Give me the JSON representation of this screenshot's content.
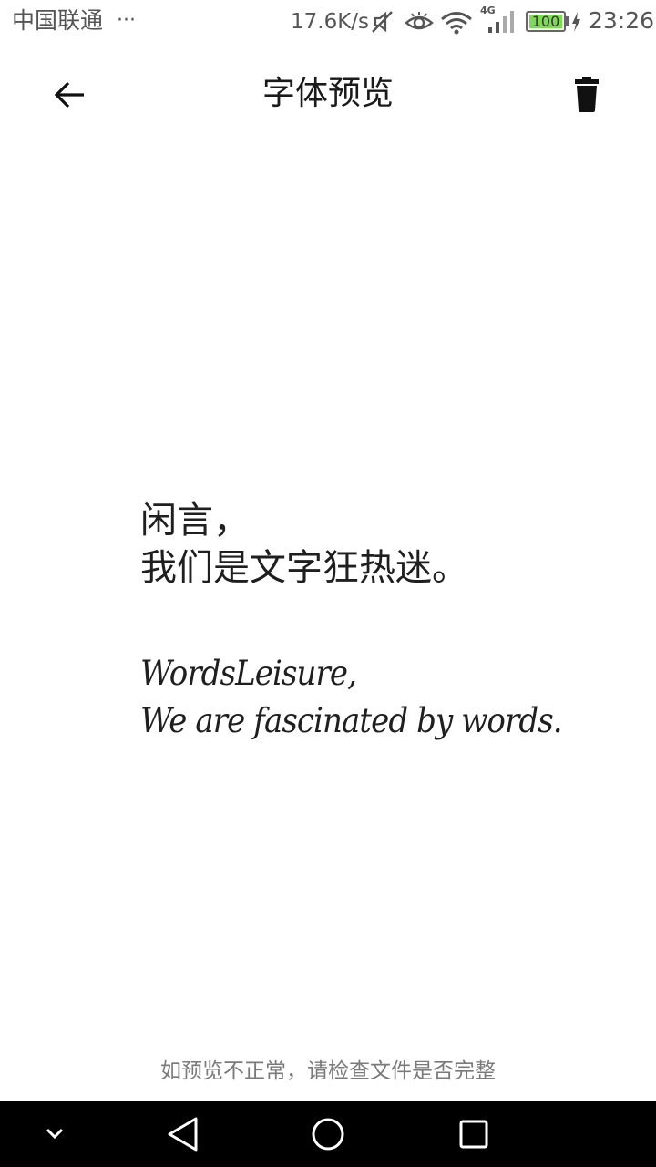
{
  "status_bar": {
    "carrier": "中国联通",
    "more": "···",
    "net_speed": "17.6K/s",
    "network_type": "4G",
    "battery_level": "100",
    "time": "23:26",
    "icons": [
      "mute-icon",
      "eye-icon",
      "wifi-icon",
      "signal-icon",
      "battery-icon",
      "charging-icon"
    ]
  },
  "header": {
    "title": "字体预览",
    "back_icon": "arrow-left-icon",
    "delete_icon": "trash-icon"
  },
  "preview": {
    "chinese_lines": [
      "闲言，",
      "我们是文字狂热迷。"
    ],
    "english_lines": [
      "WordsLeisure,",
      "We are fascinated by words."
    ]
  },
  "hint": "如预览不正常，请检查文件是否完整",
  "nav_bar": {
    "icons": [
      "chevron-down-icon",
      "back-triangle-icon",
      "home-circle-icon",
      "recents-square-icon"
    ]
  },
  "colors": {
    "battery_fill": "#7ed957",
    "nav_background": "#000000",
    "hint_text": "#7a7a7a"
  }
}
